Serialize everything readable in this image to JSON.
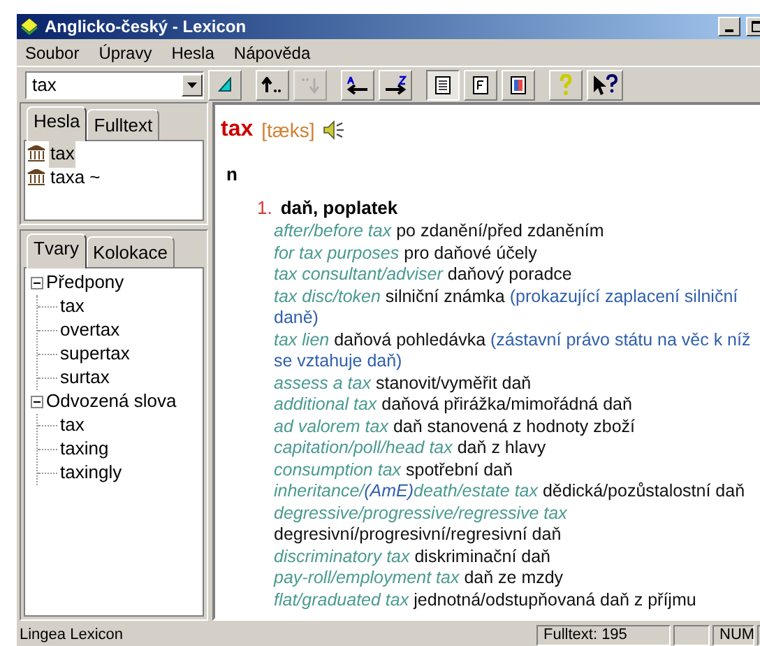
{
  "window": {
    "title": "Anglicko-český - Lexicon"
  },
  "menu": [
    "Soubor",
    "Úpravy",
    "Hesla",
    "Nápověda"
  ],
  "search": {
    "value": "tax"
  },
  "toolbar": [
    {
      "kind": "back"
    },
    {
      "kind": "up"
    },
    {
      "kind": "down",
      "disabled": true
    },
    {
      "kind": "prev"
    },
    {
      "kind": "next"
    },
    {
      "kind": "doc",
      "selected": true
    },
    {
      "kind": "form",
      "selected": false
    },
    {
      "kind": "color",
      "selected": false
    },
    {
      "kind": "help"
    },
    {
      "kind": "whatsthis"
    }
  ],
  "tabs_top": [
    {
      "label": "Hesla",
      "selected": true
    },
    {
      "label": "Fulltext",
      "selected": false
    }
  ],
  "headwords": [
    {
      "label": "tax",
      "selected": true
    },
    {
      "label": "taxa ~",
      "selected": false
    }
  ],
  "tabs_bottom": [
    {
      "label": "Tvary",
      "selected": true
    },
    {
      "label": "Kolokace",
      "selected": false
    }
  ],
  "tree": [
    {
      "label": "Předpony",
      "expanded": true,
      "children": [
        {
          "label": "tax"
        },
        {
          "label": "overtax"
        },
        {
          "label": "supertax"
        },
        {
          "label": "surtax"
        }
      ]
    },
    {
      "label": "Odvozená slova",
      "expanded": true,
      "children": [
        {
          "label": "tax"
        },
        {
          "label": "taxing"
        },
        {
          "label": "taxingly"
        }
      ]
    }
  ],
  "entry": {
    "headword": "tax",
    "pronunciation": "[tæks]",
    "pos": "n",
    "sense_number": "1.",
    "sense": "daň, poplatek",
    "examples": [
      {
        "parts": [
          {
            "kind": "phrase",
            "text": "after/before tax"
          },
          {
            "kind": "translation",
            "text": "po zdanění/před zdaněním"
          }
        ]
      },
      {
        "parts": [
          {
            "kind": "phrase",
            "text": "for tax purposes"
          },
          {
            "kind": "translation",
            "text": "pro daňové účely"
          }
        ]
      },
      {
        "parts": [
          {
            "kind": "phrase",
            "text": "tax consultant/adviser"
          },
          {
            "kind": "translation",
            "text": "daňový poradce"
          }
        ]
      },
      {
        "parts": [
          {
            "kind": "phrase",
            "text": "tax disc/token"
          },
          {
            "kind": "translation",
            "text": "silniční známka"
          },
          {
            "kind": "note",
            "text": "(prokazující zaplacení silniční  daně)"
          }
        ]
      },
      {
        "parts": [
          {
            "kind": "phrase",
            "text": "tax lien"
          },
          {
            "kind": "translation",
            "text": "daňová pohledávka"
          },
          {
            "kind": "note",
            "text": "(zástavní právo státu na věc k níž  se vztahuje daň)"
          }
        ]
      },
      {
        "parts": [
          {
            "kind": "phrase",
            "text": "assess a tax"
          },
          {
            "kind": "translation",
            "text": "stanovit/vyměřit daň"
          }
        ]
      },
      {
        "parts": [
          {
            "kind": "phrase",
            "text": "additional tax"
          },
          {
            "kind": "translation",
            "text": "daňová přirážka/mimořádná daň"
          }
        ]
      },
      {
        "parts": [
          {
            "kind": "phrase",
            "text": "ad valorem tax"
          },
          {
            "kind": "translation",
            "text": "daň stanovená z hodnoty zboží"
          }
        ]
      },
      {
        "parts": [
          {
            "kind": "phrase",
            "text": "capitation/poll/head tax"
          },
          {
            "kind": "translation",
            "text": "daň z hlavy"
          }
        ]
      },
      {
        "parts": [
          {
            "kind": "phrase",
            "text": "consumption tax"
          },
          {
            "kind": "translation",
            "text": "spotřební daň"
          }
        ]
      },
      {
        "parts": [
          {
            "kind": "phrase",
            "text": "inheritance/"
          },
          {
            "kind": "label",
            "text": "(AmE)"
          },
          {
            "kind": "phrase",
            "text": "death/estate tax"
          },
          {
            "kind": "translation",
            "text": "dědická/pozůstalostní daň"
          }
        ]
      },
      {
        "parts": [
          {
            "kind": "phrase",
            "text": "degressive/progressive/regressive tax"
          },
          {
            "kind": "translation",
            "text": "degresivní/progresivní/regresivní daň"
          }
        ]
      },
      {
        "parts": [
          {
            "kind": "phrase",
            "text": "discriminatory tax"
          },
          {
            "kind": "translation",
            "text": "diskriminační daň"
          }
        ]
      },
      {
        "parts": [
          {
            "kind": "phrase",
            "text": "pay-roll/employment tax"
          },
          {
            "kind": "translation",
            "text": "daň ze mzdy"
          }
        ]
      },
      {
        "parts": [
          {
            "kind": "phrase",
            "text": "flat/graduated tax"
          },
          {
            "kind": "translation",
            "text": "jednotná/odstupňovaná daň z příjmu"
          }
        ]
      }
    ]
  },
  "status_bar": {
    "app": "Lingea Lexicon",
    "fulltext": "Fulltext: 195",
    "indicator": "NUM"
  }
}
